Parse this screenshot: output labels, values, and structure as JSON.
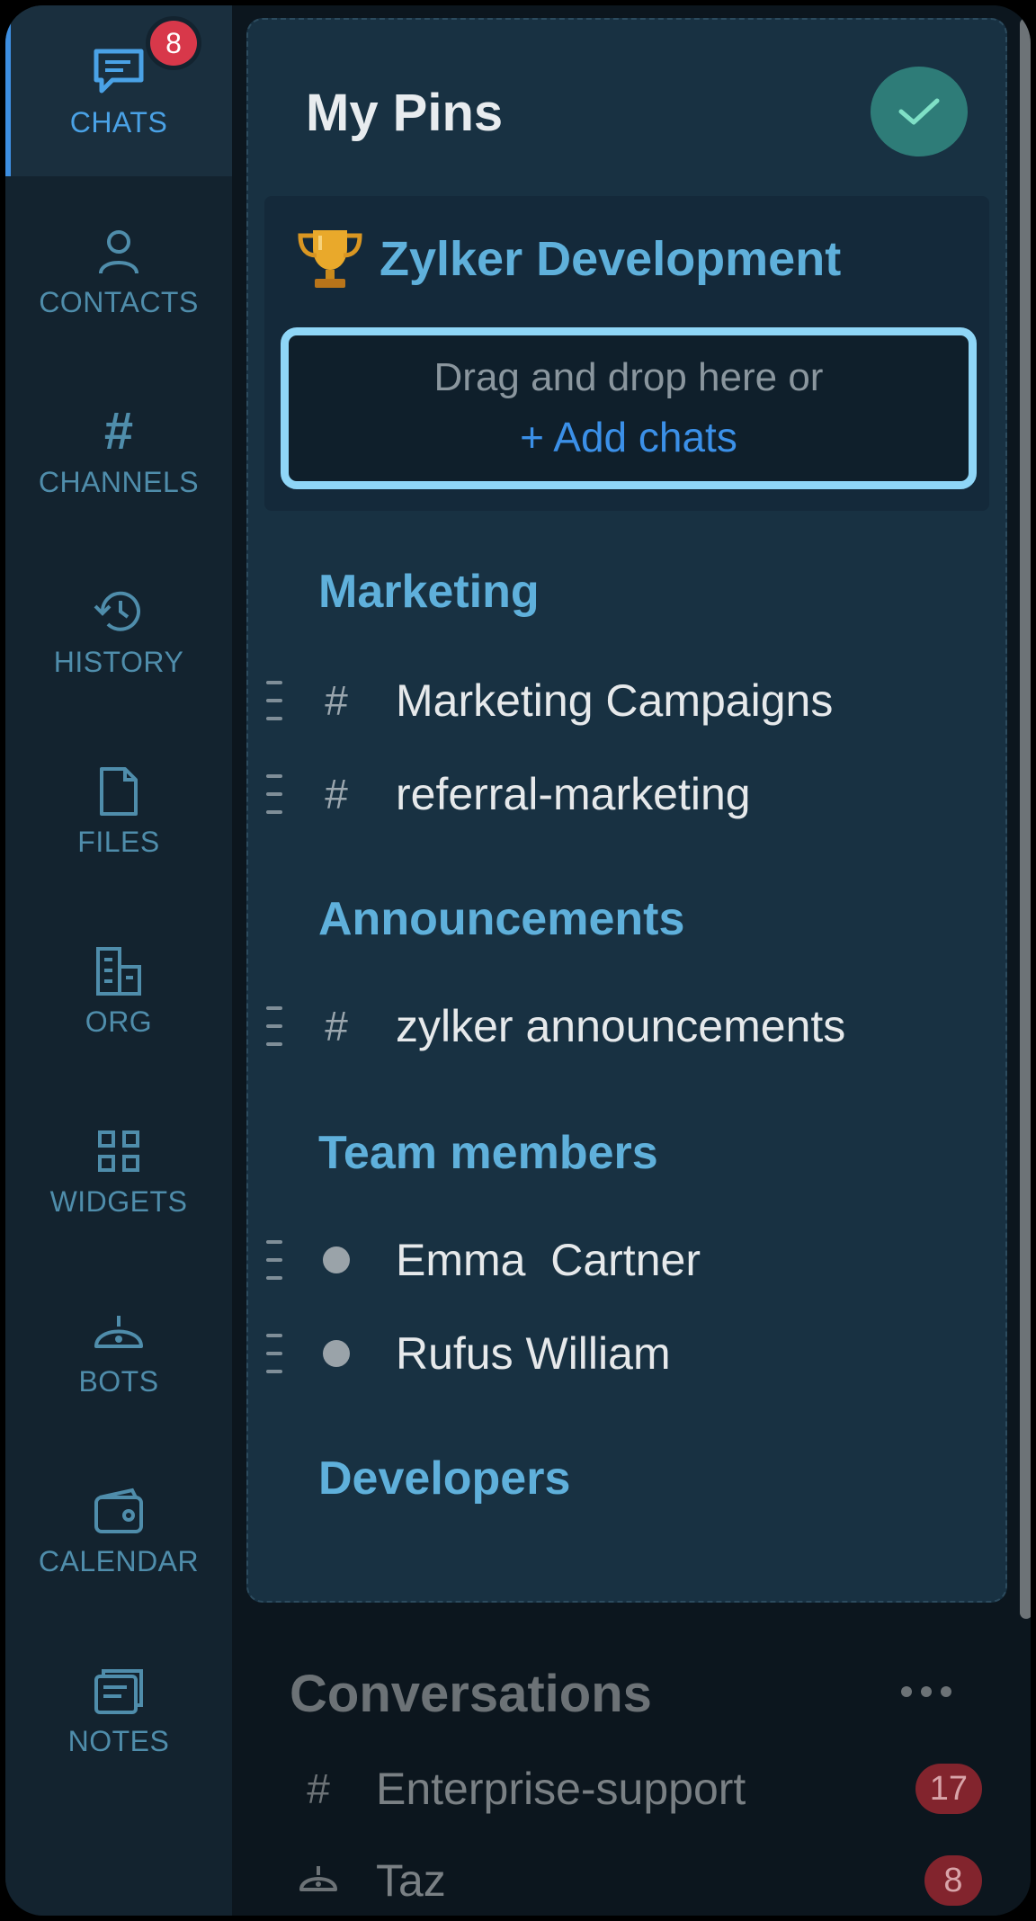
{
  "nav": {
    "items": [
      {
        "label": "CHATS",
        "icon": "chat-icon",
        "badge": "8",
        "active": true
      },
      {
        "label": "CONTACTS",
        "icon": "contact-icon"
      },
      {
        "label": "CHANNELS",
        "icon": "hash-icon"
      },
      {
        "label": "HISTORY",
        "icon": "history-icon"
      },
      {
        "label": "FILES",
        "icon": "file-icon"
      },
      {
        "label": "ORG",
        "icon": "org-icon"
      },
      {
        "label": "WIDGETS",
        "icon": "widgets-icon"
      },
      {
        "label": "BOTS",
        "icon": "bot-icon"
      },
      {
        "label": "CALENDAR",
        "icon": "calendar-icon"
      },
      {
        "label": "NOTES",
        "icon": "notes-icon"
      }
    ]
  },
  "pins": {
    "title": "My Pins",
    "group": {
      "title": "Zylker Development",
      "icon": "trophy-icon",
      "drop_text": "Drag and drop here or",
      "add_label": "+ Add chats"
    },
    "sections": [
      {
        "title": "Marketing",
        "items": [
          {
            "type": "#",
            "label": "Marketing Campaigns"
          },
          {
            "type": "#",
            "label": "referral-marketing"
          }
        ]
      },
      {
        "title": "Announcements",
        "items": [
          {
            "type": "#",
            "label": "zylker announcements"
          }
        ]
      },
      {
        "title": "Team members",
        "items": [
          {
            "type": "dot",
            "label": "Emma  Cartner"
          },
          {
            "type": "dot",
            "label": "Rufus William"
          }
        ]
      },
      {
        "title": "Developers",
        "items": []
      }
    ]
  },
  "conversations": {
    "title": "Conversations",
    "items": [
      {
        "type": "#",
        "label": "Enterprise-support",
        "count": "17"
      },
      {
        "type": "bot",
        "label": "Taz",
        "count": "8"
      }
    ]
  },
  "colors": {
    "accent": "#3b90e8",
    "section": "#5fb0db",
    "badge": "#d8384a",
    "confirm": "#2e7c78"
  }
}
